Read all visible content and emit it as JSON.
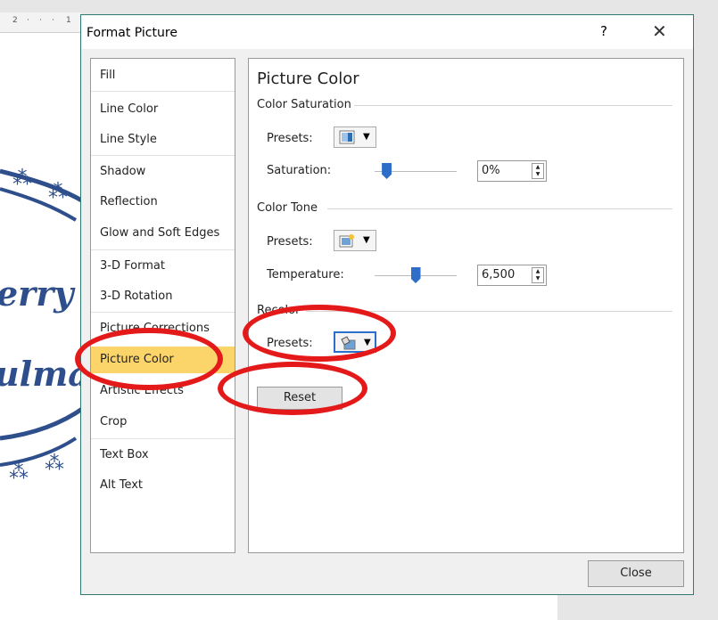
{
  "dialog": {
    "title": "Format Picture",
    "help_label": "?",
    "close_glyph": "✕",
    "close_button_label": "Close"
  },
  "ruler": {
    "marks": [
      "2",
      "·",
      "·",
      "·",
      "1"
    ]
  },
  "document": {
    "text_fragments": [
      "erry",
      "ulma"
    ]
  },
  "sidebar": {
    "items": [
      {
        "label": "Fill"
      },
      {
        "label": "Line Color"
      },
      {
        "label": "Line Style"
      },
      {
        "label": "Shadow"
      },
      {
        "label": "Reflection"
      },
      {
        "label": "Glow and Soft Edges"
      },
      {
        "label": "3-D Format"
      },
      {
        "label": "3-D Rotation"
      },
      {
        "label": "Picture Corrections"
      },
      {
        "label": "Picture Color",
        "active": true
      },
      {
        "label": "Artistic Effects"
      },
      {
        "label": "Crop"
      },
      {
        "label": "Text Box"
      },
      {
        "label": "Alt Text"
      }
    ]
  },
  "panel": {
    "title": "Picture Color",
    "saturation_group": {
      "title": "Color Saturation",
      "presets_label": "Presets:",
      "saturation_label": "Saturation:",
      "saturation_value": "0%",
      "slider_fraction": 0.1
    },
    "tone_group": {
      "title": "Color Tone",
      "presets_label": "Presets:",
      "temperature_label": "Temperature:",
      "temperature_value": "6,500",
      "slider_fraction": 0.5
    },
    "recolor_group": {
      "title": "Recolor",
      "presets_label": "Presets:",
      "reset_label": "Reset"
    }
  },
  "colors": {
    "accent": "#2e6ec8",
    "active_item": "#fbd56a",
    "annotation_red": "#e41a1a"
  }
}
